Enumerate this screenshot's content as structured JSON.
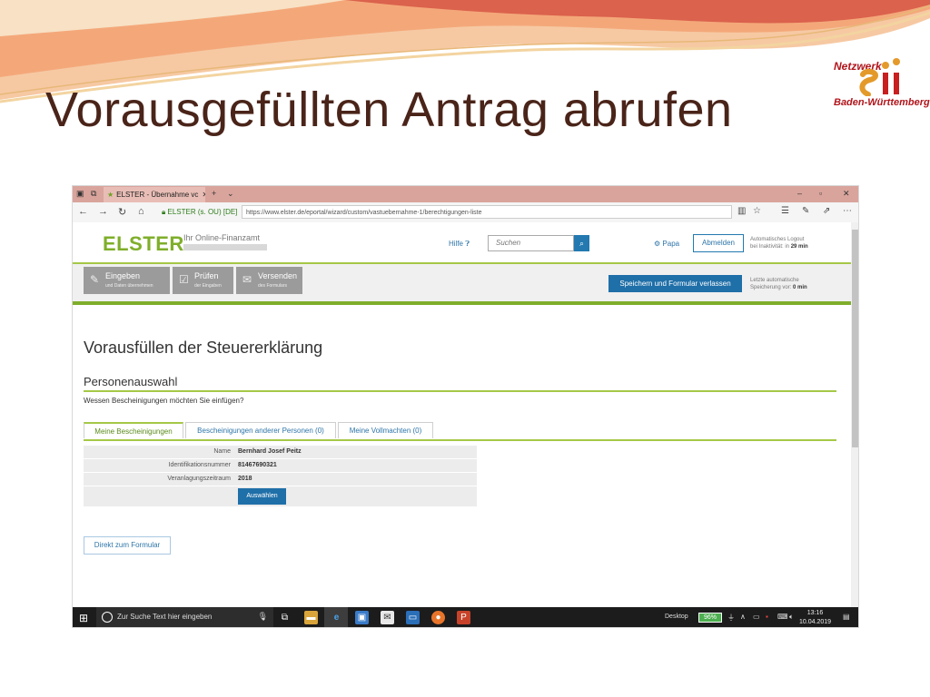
{
  "slide": {
    "title": "Vorausgefüllten Antrag abrufen",
    "logo_line1": "Netzwerk",
    "logo_line2": "Baden-Württemberg"
  },
  "browser": {
    "tab_title": "ELSTER - Übernahme vc",
    "site_identity": "ELSTER (s. OU) [DE]",
    "url": "https://www.elster.de/eportal/wizard/custom/vastuebernahme-1/berechtigungen-liste"
  },
  "header": {
    "brand": "ELSTER",
    "tagline": "Ihr Online-Finanzamt",
    "help_label": "Hilfe",
    "search_placeholder": "Suchen",
    "user_label": "Papa",
    "logout_label": "Abmelden",
    "autologout_line1": "Automatisches Logout",
    "autologout_prefix": "bei Inaktivität: in",
    "autologout_time": "29 min"
  },
  "steps": [
    {
      "title": "Eingeben",
      "sub": "und Daten übernehmen"
    },
    {
      "title": "Prüfen",
      "sub": "der Eingaben"
    },
    {
      "title": "Versenden",
      "sub": "des Formulars"
    }
  ],
  "save_button": "Speichern und Formular verlassen",
  "autosave_line1": "Letzte automatische",
  "autosave_prefix": "Speicherung vor:",
  "autosave_time": "0 min",
  "main": {
    "heading": "Vorausfüllen der Steuererklärung",
    "subheading": "Personenauswahl",
    "question": "Wessen Bescheinigungen möchten Sie einfügen?",
    "tabs": [
      {
        "label": "Meine Bescheinigungen"
      },
      {
        "label": "Bescheinigungen anderer Personen (0)"
      },
      {
        "label": "Meine Vollmachten (0)"
      }
    ],
    "rows": [
      {
        "key": "Name",
        "value": "Bernhard Josef Peitz"
      },
      {
        "key": "Identifikationsnummer",
        "value": "81467690321"
      },
      {
        "key": "Veranlagungszeitraum",
        "value": "2018"
      }
    ],
    "select_button": "Auswählen",
    "direct_button": "Direkt zum Formular"
  },
  "taskbar": {
    "search_placeholder": "Zur Suche Text hier eingeben",
    "desktop_label": "Desktop",
    "battery": "96%",
    "time": "13:16",
    "date": "10.04.2019"
  },
  "colors": {
    "slide_title": "#4a2419",
    "elster_green": "#7fae2a",
    "accent_line": "#a5c847",
    "button_blue": "#1f6fa8",
    "logo_red": "#b1151b"
  }
}
